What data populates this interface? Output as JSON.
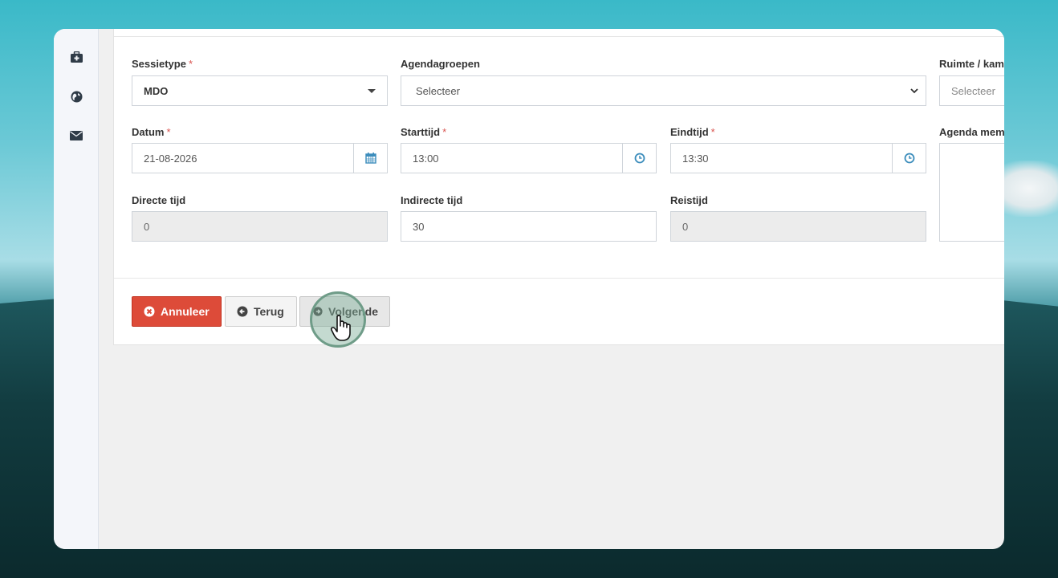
{
  "form": {
    "sessietype": {
      "label": "Sessietype",
      "required": "*",
      "value": "MDO"
    },
    "agendagroepen": {
      "label": "Agendagroepen",
      "value": "Selecteer"
    },
    "ruimte": {
      "label": "Ruimte / kam",
      "value": "Selecteer"
    },
    "datum": {
      "label": "Datum",
      "required": "*",
      "value": "21-08-2026"
    },
    "starttijd": {
      "label": "Starttijd",
      "required": "*",
      "value": "13:00"
    },
    "eindtijd": {
      "label": "Eindtijd",
      "required": "*",
      "value": "13:30"
    },
    "agenda_memo": {
      "label": "Agenda mem"
    },
    "directe_tijd": {
      "label": "Directe tijd",
      "value": "0"
    },
    "indirecte_tijd": {
      "label": "Indirecte tijd",
      "value": "30"
    },
    "reistijd": {
      "label": "Reistijd",
      "value": "0"
    }
  },
  "buttons": {
    "annuleer": "Annuleer",
    "terug": "Terug",
    "volgende": "Volgende"
  },
  "sidebar": {
    "icons": [
      "medkit-icon",
      "globe-icon",
      "envelope-icon"
    ]
  },
  "colors": {
    "danger": "#dd4b39",
    "required": "#d9534f",
    "icon_blue": "#3c8dbc"
  }
}
